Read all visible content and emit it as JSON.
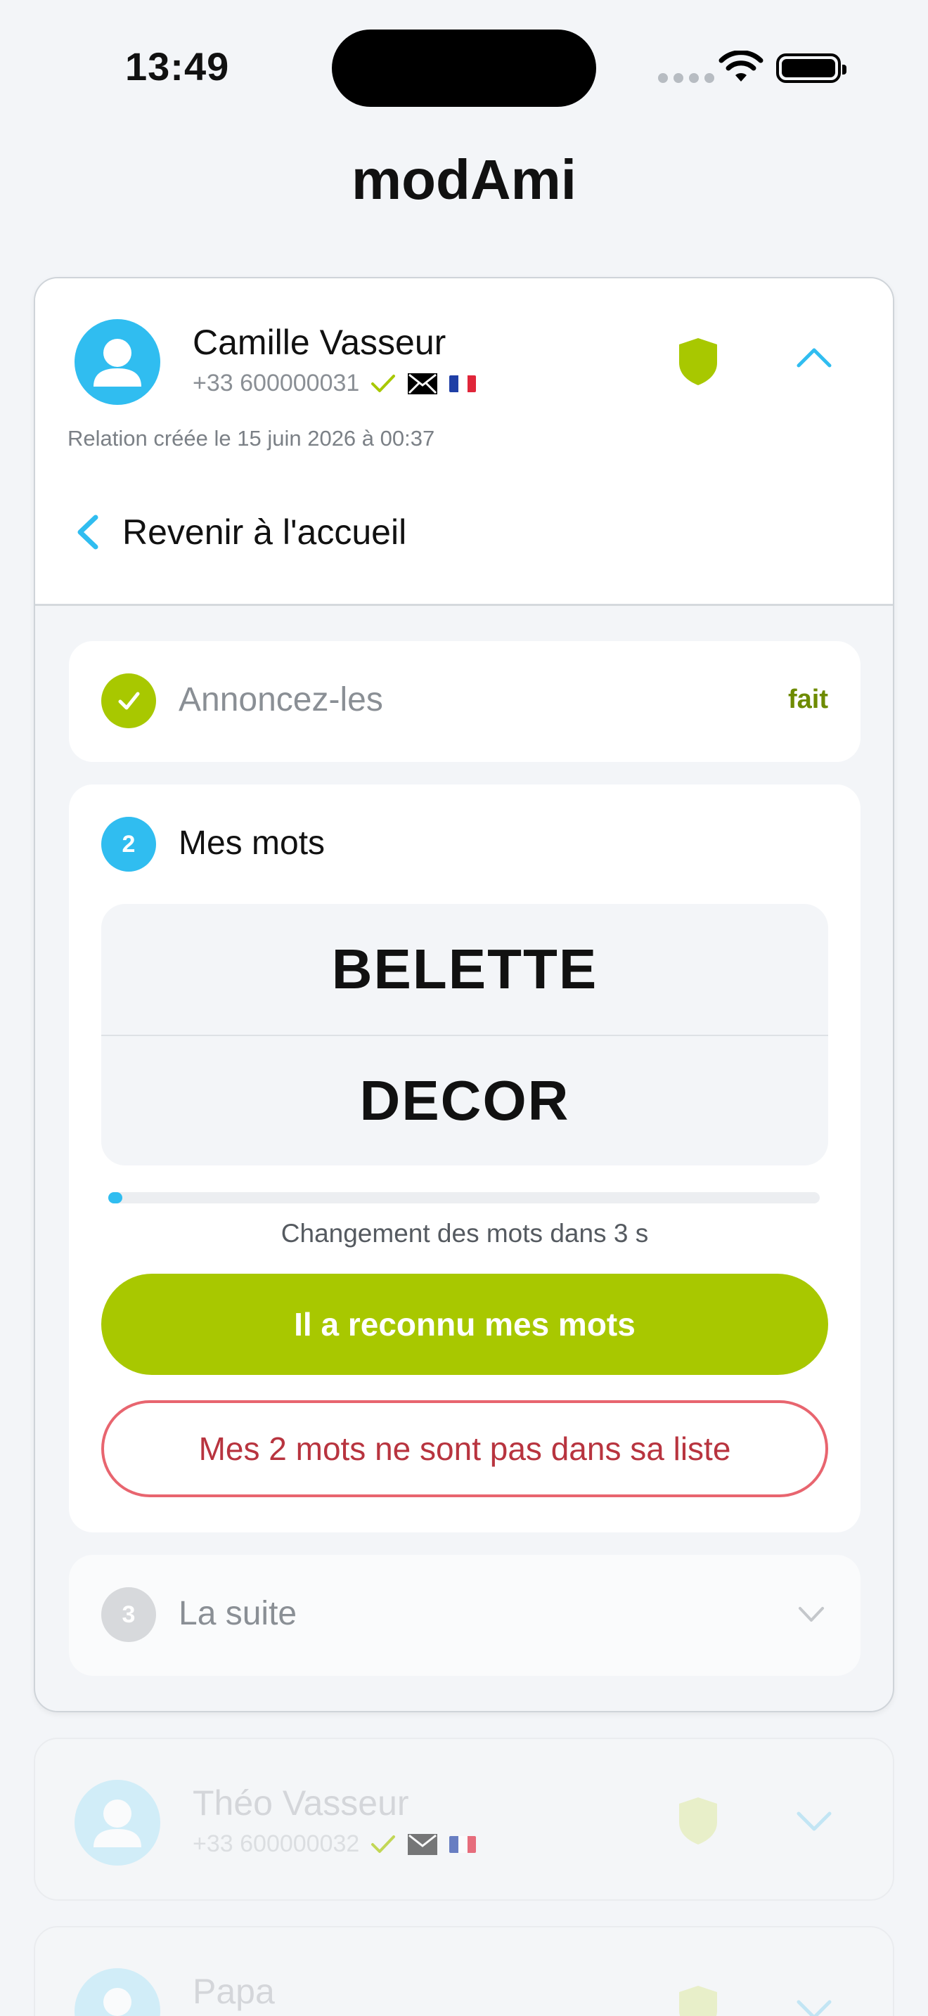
{
  "status_bar": {
    "time": "13:49"
  },
  "app": {
    "title": "modAmi"
  },
  "active_contact": {
    "name": "Camille Vasseur",
    "phone": "+33 600000031",
    "relation_text": "Relation créée le 15 juin 2026 à 00:37",
    "back_label": "Revenir à l'accueil"
  },
  "steps": [
    {
      "number": "1",
      "title": "Annoncez-les",
      "status": "fait"
    },
    {
      "number": "2",
      "title": "Mes mots",
      "words": [
        "BELETTE",
        "DECOR"
      ],
      "progress": 0.02,
      "countdown": "Changement des mots dans 3 s",
      "primary_button": "Il a reconnu mes mots",
      "secondary_button": "Mes 2 mots ne sont pas dans sa liste"
    },
    {
      "number": "3",
      "title": "La suite"
    }
  ],
  "other_contacts": [
    {
      "name": "Théo Vasseur",
      "phone": "+33 600000032"
    },
    {
      "name": "Papa",
      "phone": ""
    }
  ],
  "colors": {
    "accent_blue": "#30bdf0",
    "accent_green": "#a8c800",
    "danger_red": "#e8656f"
  }
}
